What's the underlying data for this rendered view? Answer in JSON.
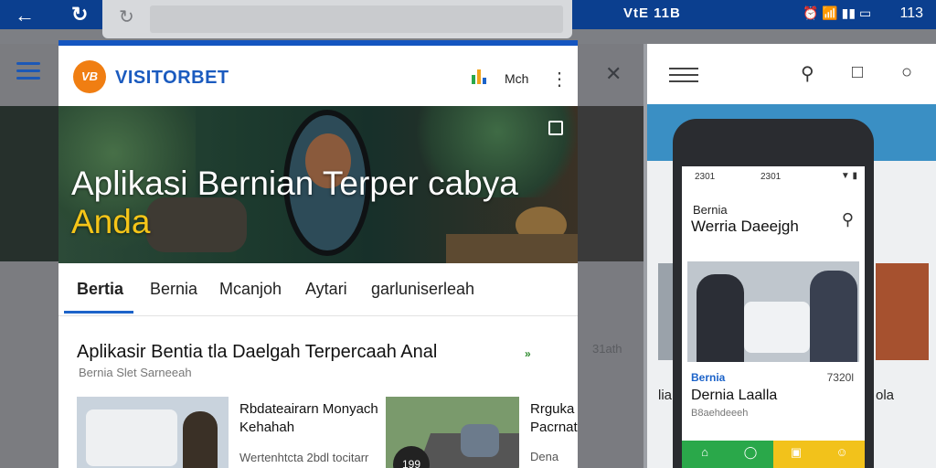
{
  "status_bar": {
    "back_icon": "arrow-left-icon",
    "refresh_icon": "refresh-icon",
    "notification_icons": "VtE 11B",
    "time": "113"
  },
  "left_site": {
    "brand": "VISITORBET",
    "header_label": "Mch",
    "hero_title": "Aplikasi Bernian Terper cabya",
    "hero_highlight": "Anda",
    "tabs": [
      "Bertia",
      "Bernia",
      "Mcanjoh",
      "Aytari",
      "garluniserleah"
    ],
    "section_title": "Aplikasir Bentia tla  Daelgah Terpercaah  Anal",
    "section_sub": "Bernia Slet Sarneeah",
    "section_badge": "»",
    "articles": [
      {
        "title": "Rbdateairarn Monyach Kehahah",
        "meta": "Wertenhtcta 2bdl tocitarr"
      },
      {
        "title": "Rrguka Pacrnat",
        "meta": "Dena"
      }
    ],
    "thumb2_badge": "199"
  },
  "mid_panel": {
    "faded_text": "31ath"
  },
  "right_panel": {
    "side_labels": [
      "lia",
      "ola"
    ]
  },
  "phone": {
    "status_left": "2301",
    "status_mid": "2301",
    "section_small": "Bernia",
    "section_title": "Werria Daeejgh",
    "card_category": "Bernia",
    "card_date": "7320l",
    "card_title": "Dernia Laalla",
    "card_meta": "B8aehdeeeh",
    "nav_items": [
      "Home",
      "Berita",
      "Daerah",
      "Profil"
    ],
    "nav_colors": [
      "#2aa84a",
      "#2aa84a",
      "#f2c21b",
      "#f2c21b"
    ]
  },
  "colors": {
    "statusbar": "#0b3f8f",
    "brand_blue": "#1b5bbf",
    "accent_yellow": "#f5c518"
  }
}
